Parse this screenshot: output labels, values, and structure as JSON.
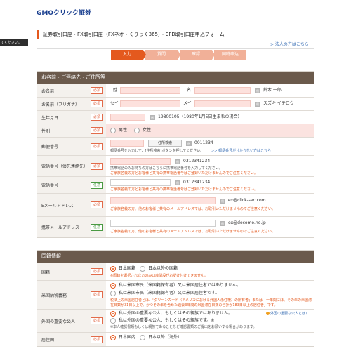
{
  "header": {
    "logo_gmo": "GMO",
    "logo_rest": "クリック証券"
  },
  "left_tab": {
    "text": "てください。"
  },
  "page": {
    "title": "証券取引口座・FX取引口座（FXネオ・くりっく365）・CFD取引口座申込フォーム",
    "corp_link": "> 法人の方はこちら"
  },
  "steps": [
    {
      "label": "入力"
    },
    {
      "label": "質問"
    },
    {
      "label": "確認"
    },
    {
      "label": "同時申込"
    }
  ],
  "personal": {
    "heading": "お名前・ご連絡先・ご住所等",
    "required": "必須",
    "optional": "任意",
    "example_tag": "例",
    "name": {
      "label": "お名前",
      "sei": "姓",
      "mei": "名",
      "example": "鈴木 一郎"
    },
    "kana": {
      "label": "お名前（フリガナ）",
      "sei": "セイ",
      "mei": "メイ",
      "example": "スズキ イチロウ"
    },
    "birthdate": {
      "label": "生年月日",
      "example": "19800105（1980年1月5日生まれの場合）"
    },
    "gender": {
      "label": "性別",
      "options": [
        "男性",
        "女性"
      ]
    },
    "postal": {
      "label": "郵便番号",
      "button": "住所検索",
      "example": "0011234",
      "note": "郵便番号を入力して、[住所検索]ボタンを押してください。",
      "note_link": ">> 郵便番号が分からない方はこちら"
    },
    "phone_main": {
      "label": "電話番号（優先連絡先）",
      "example": "0312341234",
      "note": "携帯電話のみお持ちの方はこちらに携帯電話番号を入力してください。",
      "warn": "ご家族名義の方とお客様と共有の携帯電話番号はご登録いただけませんのでご注意ください。"
    },
    "phone_sub": {
      "label": "電話番号",
      "example": "0312341234",
      "warn": "ご家族名義の方とお客様と共有の携帯電話番号はご登録いただけませんのでご注意ください。"
    },
    "email": {
      "label": "Eメールアドレス",
      "example": "ex@click-sec.com",
      "warn": "ご家族名義の方、他のお客様と共有のメールアドレスでは、お取引いただけませんのでご注意ください。"
    },
    "mobile_email": {
      "label": "携帯メールアドレス",
      "example": "ex@docomo.ne.jp",
      "warn": "ご家族名義の方、他のお客様と共有のメールアドレスでは、お取引いただけませんのでご注意ください。"
    }
  },
  "nationality": {
    "heading": "国籍情報",
    "country": {
      "label": "国籍",
      "options": [
        "日本国籍",
        "日本以外の国籍"
      ],
      "warn": "※国籍を選択された方のみ口座開設がお受け付けできません。"
    },
    "us_tax": {
      "label": "米国納税義務",
      "options": [
        "私は米国市民（米国籍保有者）又は米国居住者ではありません。",
        "私は米国市民（米国籍保有者）又は米国居住者です。"
      ],
      "warn1": "税法上の米国居住者とは、「グリーンカード（アメリカにおける外国人永住権）の所有者」または「一年間にほ、その年の米国滞",
      "warn2": "在日数が31日以上で、かつその年を含めた過去3年間の米国滞在日数の合計が183日以上の居住者」です。"
    },
    "peps": {
      "label": "外国の重要な公人",
      "options": [
        "私は外国の重要な公人、もしくはその親族ではありません。",
        "私は外国の重要な公人、もしくはその親族です。※"
      ],
      "help": "外国の重要な公人とは？",
      "note": "※本人確認書類もしくは親族であることなど確認書類のご提出をお願いする場合があります。"
    },
    "residence": {
      "label": "居住国",
      "options": [
        "日本国内",
        "日本以外（海外）"
      ]
    }
  }
}
